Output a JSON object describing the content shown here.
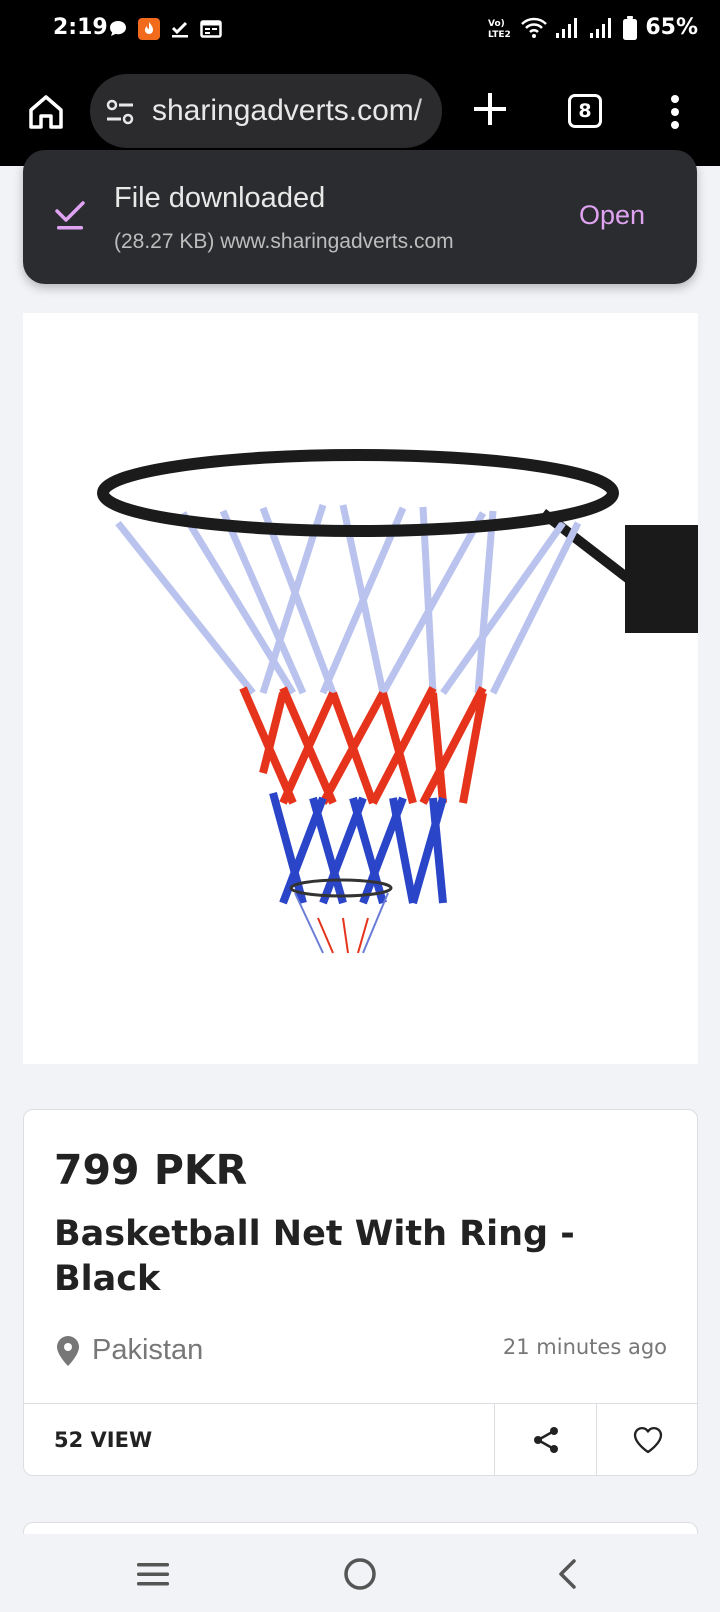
{
  "status_bar": {
    "time": "2:19",
    "network_label": "Vo) LTE2",
    "battery_percent": "65%"
  },
  "browser": {
    "url": "sharingadverts.com/",
    "tab_count": "8"
  },
  "download_toast": {
    "title": "File downloaded",
    "details": "(28.27 KB) www.sharingadverts.com",
    "action_label": "Open",
    "accent_color": "#e0a3f2"
  },
  "listing": {
    "price": "799 PKR",
    "title": "Basketball Net With Ring - Black",
    "location": "Pakistan",
    "posted": "21 minutes ago",
    "views": "52 VIEW"
  }
}
